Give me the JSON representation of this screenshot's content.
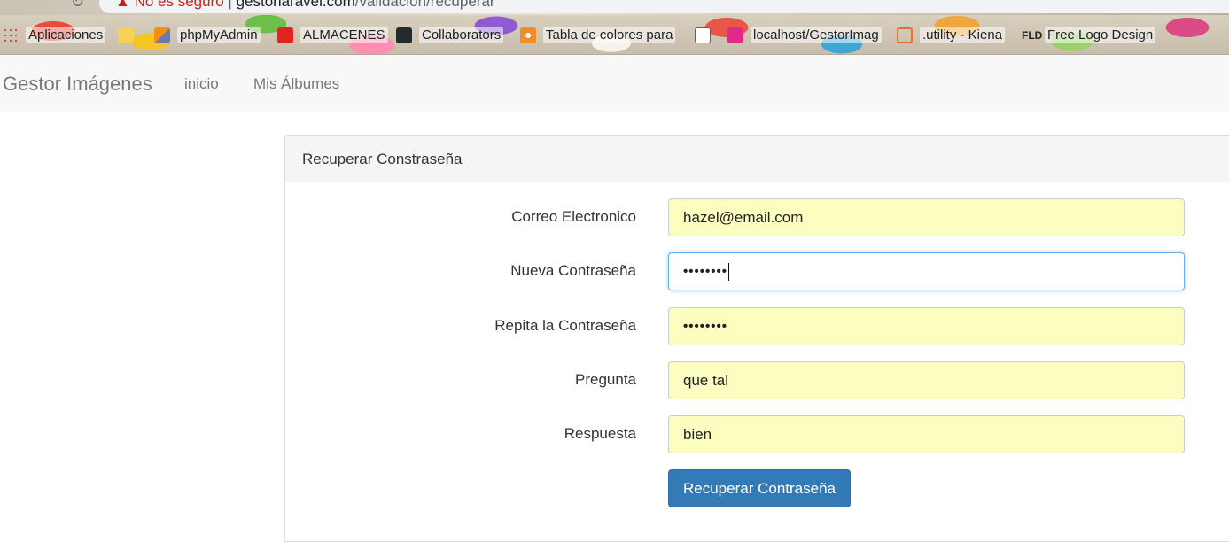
{
  "browser": {
    "address": {
      "warning": "No es seguro",
      "separator": "|",
      "host": "gestorlaravel.com",
      "path": "/validacion/recuperar"
    },
    "bookmarks": [
      {
        "label": "Aplicaciones",
        "icon": "apps-grid-icon"
      },
      {
        "label": "",
        "icon": "folder-icon"
      },
      {
        "label": "phpMyAdmin",
        "icon": "phpmyadmin-icon"
      },
      {
        "label": "ALMACENES",
        "icon": "terminal-icon"
      },
      {
        "label": "Collaborators",
        "icon": "github-icon"
      },
      {
        "label": "Tabla de colores para",
        "icon": "palette-icon"
      },
      {
        "label": "",
        "icon": "document-icon"
      },
      {
        "label": "localhost/GestorImag",
        "icon": "wamp-icon"
      },
      {
        "label": ".utility - Kiena",
        "icon": "cloud-icon"
      },
      {
        "label": "Free Logo Design",
        "icon": "fld-icon"
      }
    ]
  },
  "navbar": {
    "brand": "Gestor Imágenes",
    "links": [
      "inicio",
      "Mis Álbumes"
    ]
  },
  "panel": {
    "heading": "Recuperar Constraseña",
    "fields": [
      {
        "label": "Correo Electronico",
        "value": "hazel@email.com",
        "type": "email",
        "autofill": true
      },
      {
        "label": "Nueva Contraseña",
        "value": "••••••••",
        "type": "password",
        "focused": true
      },
      {
        "label": "Repita la Contraseña",
        "value": "••••••••",
        "type": "password",
        "autofill": true
      },
      {
        "label": "Pregunta",
        "value": "que tal",
        "type": "text",
        "autofill": true
      },
      {
        "label": "Respuesta",
        "value": "bien",
        "type": "text",
        "autofill": true
      }
    ],
    "submit_label": "Recuperar Contraseña"
  },
  "colors": {
    "primary": "#337ab7",
    "autofill": "#fbfebe",
    "focus_border": "#66afe9",
    "warning": "#c5221f"
  }
}
